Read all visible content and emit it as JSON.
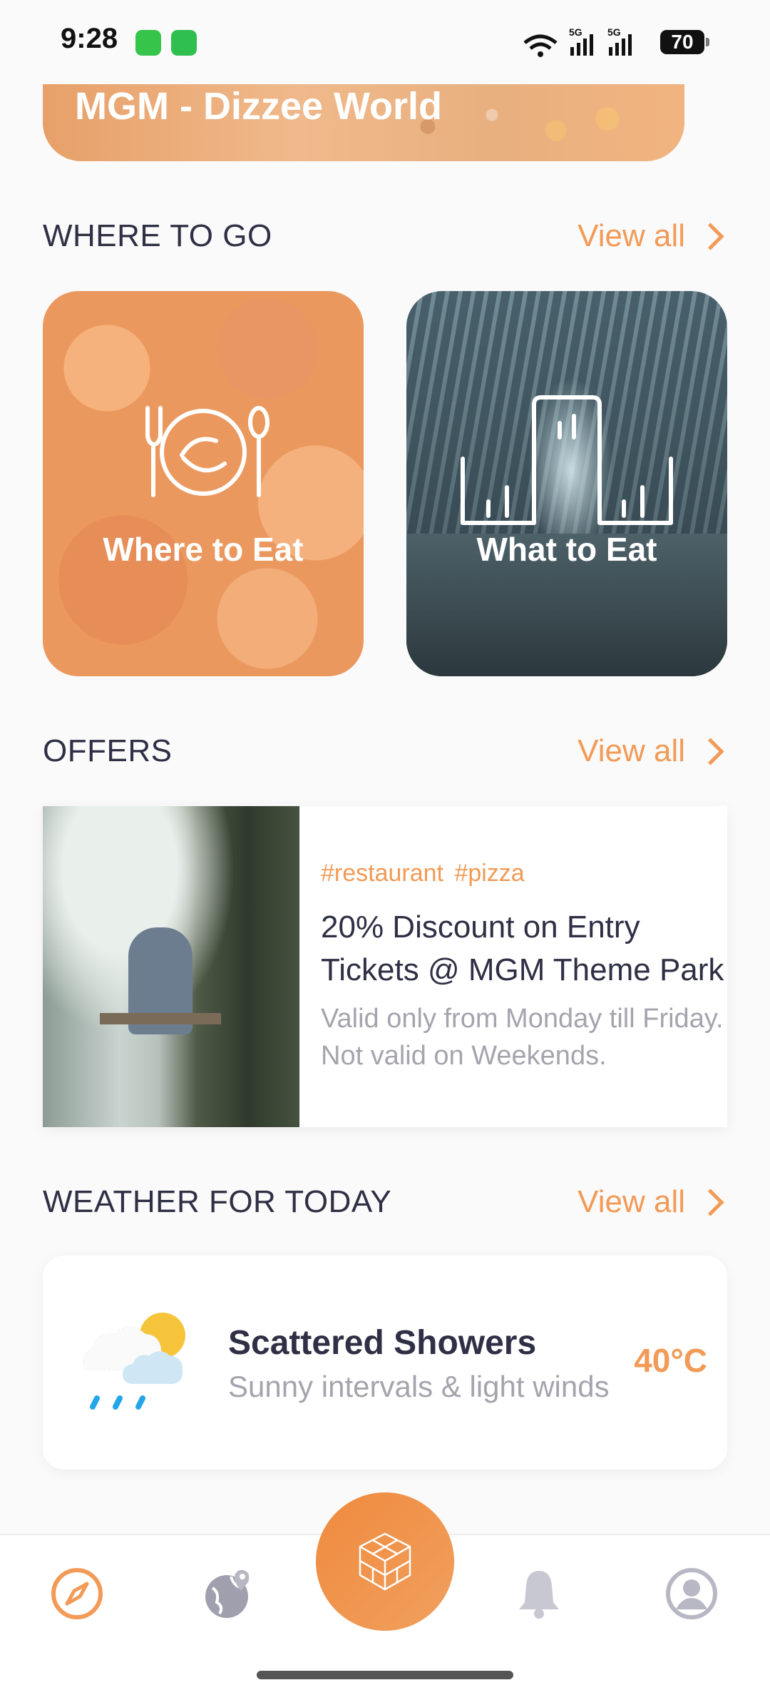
{
  "status_bar": {
    "time": "9:28",
    "battery": "70",
    "net1": "5G",
    "net2": "5G"
  },
  "banner": {
    "title": "MGM - Dizzee World"
  },
  "where_to_go": {
    "title": "WHERE TO GO",
    "view_all": "View all",
    "cards": [
      {
        "label": "Where to Eat",
        "icon": "plate-cutlery-icon"
      },
      {
        "label": "What to Eat",
        "icon": "bar-chart-icon"
      }
    ]
  },
  "offers": {
    "title": "OFFERS",
    "view_all": "View all",
    "item": {
      "tags": "#restaurant #pizza",
      "title_line1": "20% Discount on Entry",
      "title_line2": "Tickets @ MGM Theme Park",
      "desc_line1": "Valid only from Monday till Friday.",
      "desc_line2": "Not valid on Weekends."
    }
  },
  "weather": {
    "title": "WEATHER FOR TODAY",
    "view_all": "View all",
    "condition": "Scattered Showers",
    "description": "Sunny intervals & light winds",
    "temperature": "40°C"
  },
  "bottom_nav": {
    "items": [
      "compass-icon",
      "globe-pin-icon",
      "cube-icon",
      "bell-icon",
      "profile-icon"
    ]
  }
}
